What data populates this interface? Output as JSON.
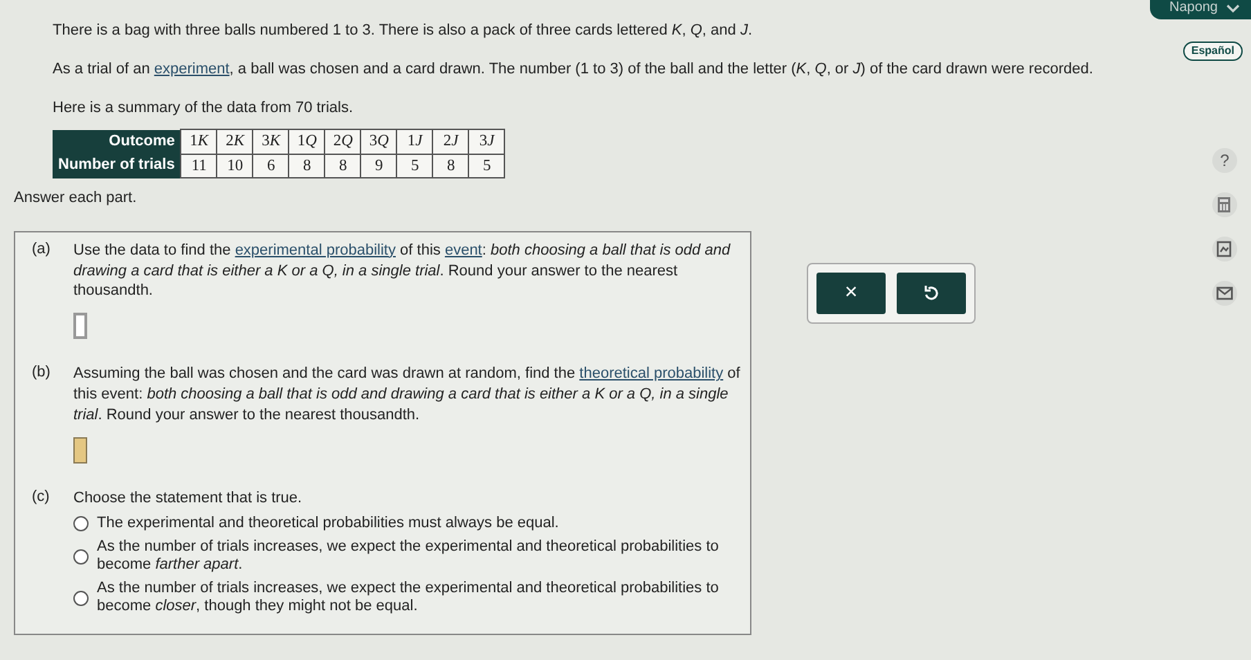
{
  "top_bar": {
    "user": "Napong"
  },
  "language_button": "Español",
  "intro": [
    "There is a bag with three balls numbered 1 to 3. There is also a pack of three cards lettered *K*, *Q*, and *J*.",
    [
      {
        "kind": "text",
        "text": "As a trial of an "
      },
      {
        "kind": "link",
        "text": "experiment"
      },
      {
        "kind": "text",
        "text": ", a ball was chosen and a card drawn. The number (1 to 3) of the ball and the letter (*K*, *Q*, or *J*) of the card drawn were recorded."
      }
    ],
    "Here is a summary of the data from 70 trials."
  ],
  "table": {
    "row_headers": [
      "Outcome",
      "Number of trials"
    ],
    "outcomes": [
      {
        "number": "1",
        "letter": "K"
      },
      {
        "number": "2",
        "letter": "K"
      },
      {
        "number": "3",
        "letter": "K"
      },
      {
        "number": "1",
        "letter": "Q"
      },
      {
        "number": "2",
        "letter": "Q"
      },
      {
        "number": "3",
        "letter": "Q"
      },
      {
        "number": "1",
        "letter": "J"
      },
      {
        "number": "2",
        "letter": "J"
      },
      {
        "number": "3",
        "letter": "J"
      }
    ],
    "counts": [
      "11",
      "10",
      "6",
      "8",
      "8",
      "9",
      "5",
      "8",
      "5"
    ]
  },
  "instruction": "Answer each part.",
  "parts": [
    {
      "kind": "answer",
      "label": "(a)",
      "prompt": [
        {
          "kind": "text",
          "text": "Use the data to find the "
        },
        {
          "kind": "link",
          "text": "experimental probability"
        },
        {
          "kind": "text",
          "text": " of this "
        },
        {
          "kind": "link",
          "text": "event"
        },
        {
          "kind": "text",
          "text": ": *both choosing a ball that is odd and drawing a card that is either a K or a Q, in a single trial*. Round your answer to the nearest thousandth."
        }
      ],
      "focused": true
    },
    {
      "kind": "answer",
      "label": "(b)",
      "prompt": [
        {
          "kind": "text",
          "text": "Assuming the ball was chosen and the card was drawn at random, find the "
        },
        {
          "kind": "link",
          "text": "theoretical probability"
        },
        {
          "kind": "text",
          "text": " of this event: *both choosing a ball that is odd and drawing a card that is either a K or a Q, in a single trial*. Round your answer to the nearest thousandth."
        }
      ],
      "focused": false
    },
    {
      "kind": "choice",
      "label": "(c)",
      "prompt": [
        {
          "kind": "text",
          "text": "Choose the statement that is true."
        }
      ],
      "options": [
        {
          "text": "The experimental and theoretical probabilities must always be equal.",
          "selected": false
        },
        {
          "text": "As the number of trials increases, we expect the experimental and theoretical probabilities to become *farther apart*.",
          "selected": false
        },
        {
          "text": "As the number of trials increases, we expect the experimental and theoretical probabilities to become *closer*, though they might not be equal.",
          "selected": false
        }
      ]
    }
  ],
  "action_buttons": [
    {
      "kind": "clear",
      "label": "×"
    },
    {
      "kind": "undo"
    }
  ],
  "side_tools": [
    {
      "kind": "help",
      "label": "?"
    },
    {
      "kind": "calculator"
    },
    {
      "kind": "image"
    },
    {
      "kind": "mail"
    }
  ]
}
